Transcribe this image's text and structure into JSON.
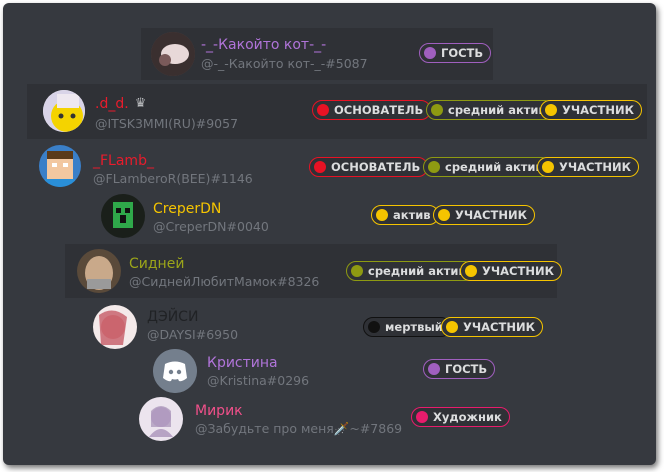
{
  "members": [
    {
      "name": "-_-Какойто кот-_-",
      "handle": "@-_-Какойто кот-_-#5087",
      "name_color": "#b074d9",
      "avatar": "cat-avatar",
      "roles": [
        {
          "label": "ГОСТЬ",
          "color": "#a05fbf"
        }
      ]
    },
    {
      "name": ".d_d.",
      "handle": "@ITSK3MMI(RU)#9057",
      "name_color": "#e81c2c",
      "avatar": "anime-avatar",
      "crown": "♛",
      "roles": [
        {
          "label": "ОСНОВАТЕЛЬ",
          "color": "#e81224"
        },
        {
          "label": "средний актив",
          "color": "#8e9a12"
        },
        {
          "label": "УЧАСТНИК",
          "color": "#f5c400"
        }
      ]
    },
    {
      "name": "_FLamb_",
      "handle": "@FLamberoR(BEE)#1146",
      "name_color": "#e81c2c",
      "avatar": "pixel-avatar",
      "roles": [
        {
          "label": "ОСНОВАТЕЛЬ",
          "color": "#e81224"
        },
        {
          "label": "средний актив",
          "color": "#8e9a12"
        },
        {
          "label": "УЧАСТНИК",
          "color": "#f5c400"
        }
      ]
    },
    {
      "name": "CreperDN",
      "handle": "@CreperDN#0040",
      "name_color": "#f5c400",
      "avatar": "creeper-avatar",
      "roles": [
        {
          "label": "актив",
          "color": "#f5c400"
        },
        {
          "label": "УЧАСТНИК",
          "color": "#f5c400"
        }
      ]
    },
    {
      "name": "Сидней",
      "handle": "@СиднейЛюбитМамок#8326",
      "name_color": "#9ba51a",
      "avatar": "face-avatar",
      "roles": [
        {
          "label": "средний актив",
          "color": "#8e9a12"
        },
        {
          "label": "УЧАСТНИК",
          "color": "#f5c400"
        }
      ]
    },
    {
      "name": "ДЭЙСИ",
      "handle": "@DAYSI#6950",
      "name_color": "#202225",
      "avatar": "girl-avatar",
      "roles": [
        {
          "label": "мертвый",
          "color": "#111111"
        },
        {
          "label": "УЧАСТНИК",
          "color": "#f5c400"
        }
      ]
    },
    {
      "name": "Кристина",
      "handle": "@Kristina#0296",
      "name_color": "#b074d9",
      "avatar": "discord-avatar",
      "roles": [
        {
          "label": "ГОСТЬ",
          "color": "#a05fbf"
        }
      ]
    },
    {
      "name": "Мирик",
      "handle": "@Забудьте про меня🗡️~#7869",
      "name_color": "#f0508a",
      "avatar": "art-avatar",
      "roles": [
        {
          "label": "Художник",
          "color": "#e81c6c"
        }
      ]
    }
  ]
}
